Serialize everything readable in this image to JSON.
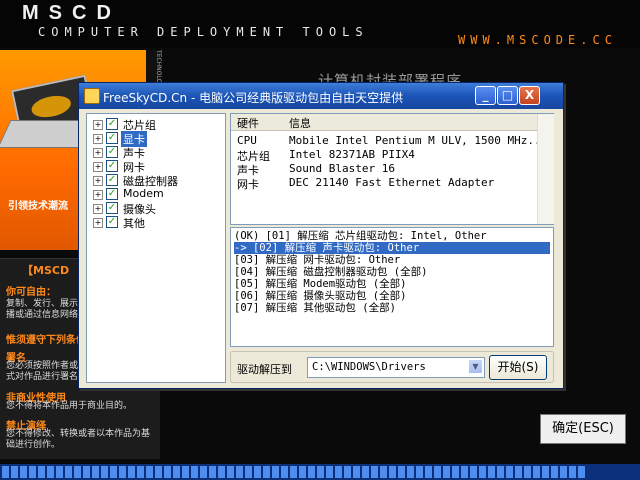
{
  "header": {
    "logo": "MSCD",
    "tagline": "COMPUTER DEPLOYMENT TOOLS",
    "website": "WWW.MSCODE.CC",
    "background_title": "计算机封装部署程序"
  },
  "left_panel": {
    "slogan": "引领技术潮流",
    "vertical_text": "TECHNOLOGY IA",
    "license_title": "【MSCD",
    "sections": [
      {
        "heading": "你可自由：",
        "text": "复制、发行、展示、表演、放映、广播或通过信息网络传播本作品"
      },
      {
        "heading": "惟须遵守下列条件：",
        "text": ""
      },
      {
        "heading": "署名",
        "text": "您必须按照作者或者许可人指定的方式对作品进行署名。"
      },
      {
        "heading": "非商业性使用",
        "text": "您不得将本作品用于商业目的。"
      },
      {
        "heading": "禁止演绎",
        "text": "您不得修改、转换或者以本作品为基础进行创作。"
      }
    ]
  },
  "dialog": {
    "title": "FreeSkyCD.Cn - 电脑公司经典版驱动包由自由天空提供",
    "minimize": "_",
    "maximize": "□",
    "close": "X",
    "tree": [
      {
        "label": "芯片组",
        "checked": true,
        "selected": false
      },
      {
        "label": "显卡",
        "checked": true,
        "selected": true
      },
      {
        "label": "声卡",
        "checked": true,
        "selected": false
      },
      {
        "label": "网卡",
        "checked": true,
        "selected": false
      },
      {
        "label": "磁盘控制器",
        "checked": true,
        "selected": false
      },
      {
        "label": "Modem",
        "checked": true,
        "selected": false
      },
      {
        "label": "摄像头",
        "checked": true,
        "selected": false
      },
      {
        "label": "其他",
        "checked": true,
        "selected": false
      }
    ],
    "hw_headers": [
      "硬件",
      "信息"
    ],
    "hw_rows": [
      [
        "CPU",
        "Mobile Intel Pentium M ULV, 1500 MHz..."
      ],
      [
        "芯片组",
        "Intel 82371AB PIIX4"
      ],
      [
        "声卡",
        "Sound Blaster 16"
      ],
      [
        "网卡",
        "DEC 21140 Fast Ethernet Adapter"
      ]
    ],
    "log": [
      {
        "text": "(OK) [01] 解压缩 芯片组驱动包: Intel, Other",
        "selected": false
      },
      {
        "text": "-> [02] 解压缩 声卡驱动包: Other",
        "selected": true
      },
      {
        "text": "[03] 解压缩 网卡驱动包: Other",
        "selected": false
      },
      {
        "text": "[04] 解压缩 磁盘控制器驱动包 (全部)",
        "selected": false
      },
      {
        "text": "[05] 解压缩 Modem驱动包 (全部)",
        "selected": false
      },
      {
        "text": "[06] 解压缩 摄像头驱动包 (全部)",
        "selected": false
      },
      {
        "text": "[07] 解压缩 其他驱动包 (全部)",
        "selected": false
      }
    ],
    "extract_label": "驱动解压到",
    "extract_path": "C:\\WINDOWS\\Drivers",
    "start_button": "开始(S)"
  },
  "confirm_button": "确定(ESC)",
  "progress": {
    "value": 0.92
  },
  "colors": {
    "accent": "#ff6a00",
    "titlebar": "#1b55b7",
    "selection": "#316ac5"
  }
}
